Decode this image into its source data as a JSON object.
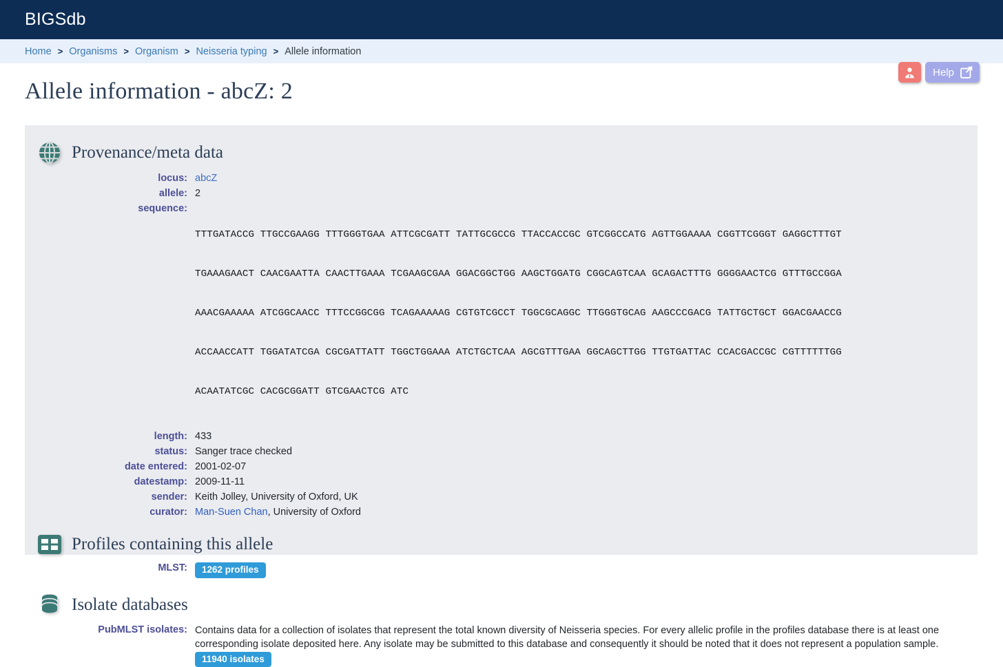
{
  "top_bar": {
    "brand": "BIGSdb"
  },
  "breadcrumb": {
    "items": [
      {
        "label": "Home",
        "link": true
      },
      {
        "label": "Organisms",
        "link": true
      },
      {
        "label": "Organism",
        "link": true
      },
      {
        "label": "Neisseria typing",
        "link": true
      },
      {
        "label": "Allele information",
        "link": false
      }
    ],
    "separator": ">"
  },
  "header_actions": {
    "user_icon": "user-person-icon",
    "help_label": "Help",
    "help_icon": "external-link-icon"
  },
  "page": {
    "title": "Allele information - abcZ: 2"
  },
  "sections": {
    "provenance": {
      "icon": "globe-icon",
      "title": "Provenance/meta data",
      "fields": {
        "locus_label": "locus:",
        "locus_value": "abcZ",
        "allele_label": "allele:",
        "allele_value": "2",
        "sequence_label": "sequence:",
        "sequence_lines": [
          "TTTGATACCG TTGCCGAAGG TTTGGGTGAA ATTCGCGATT TATTGCGCCG TTACCACCGC GTCGGCCATG AGTTGGAAAA CGGTTCGGGT GAGGCTTTGT",
          "TGAAAGAACT CAACGAATTA CAACTTGAAA TCGAAGCGAA GGACGGCTGG AAGCTGGATG CGGCAGTCAA GCAGACTTTG GGGGAACTCG GTTTGCCGGA",
          "AAACGAAAAA ATCGGCAACC TTTCCGGCGG TCAGAAAAAG CGTGTCGCCT TGGCGCAGGC TTGGGTGCAG AAGCCCGACG TATTGCTGCT GGACGAACCG",
          "ACCAACCATT TGGATATCGA CGCGATTATT TGGCTGGAAA ATCTGCTCAA AGCGTTTGAA GGCAGCTTGG TTGTGATTAC CCACGACCGC CGTTTTTTGG",
          "ACAATATCGC CACGCGGATT GTCGAACTCG ATC"
        ],
        "length_label": "length:",
        "length_value": "433",
        "status_label": "status:",
        "status_value": "Sanger trace checked",
        "date_entered_label": "date entered:",
        "date_entered_value": "2001-02-07",
        "datestamp_label": "datestamp:",
        "datestamp_value": "2009-11-11",
        "sender_label": "sender:",
        "sender_value": "Keith Jolley, University of Oxford, UK",
        "curator_label": "curator:",
        "curator_link": "Man-Suen Chan",
        "curator_rest": ", University of Oxford"
      }
    },
    "profiles": {
      "icon": "table-grid-icon",
      "title": "Profiles containing this allele",
      "mlst_label": "MLST:",
      "mlst_badge": "1262 profiles"
    },
    "isolates": {
      "icon": "database-icon",
      "title": "Isolate databases",
      "pubmlst_label": "PubMLST isolates:",
      "pubmlst_description": "Contains data for a collection of isolates that represent the total known diversity of Neisseria species. For every allelic profile in the profiles database there is at least one corresponding isolate deposited here. Any isolate may be submitted to this database and consequently it should be noted that it does not represent a population sample.",
      "pubmlst_badge": "11940 isolates"
    }
  },
  "colors": {
    "top_bar": "#0d2d55",
    "breadcrumb_bg": "#e8f0fb",
    "panel_bg": "#ebecf0",
    "icon_teal": "#3d7a76",
    "badge_blue": "#2f9bd8",
    "label_purple": "#4c4f96",
    "link_blue": "#3a79b5",
    "user_button": "#f07a75",
    "help_button": "#a3a9e8",
    "title_navy": "#2c3e56"
  }
}
